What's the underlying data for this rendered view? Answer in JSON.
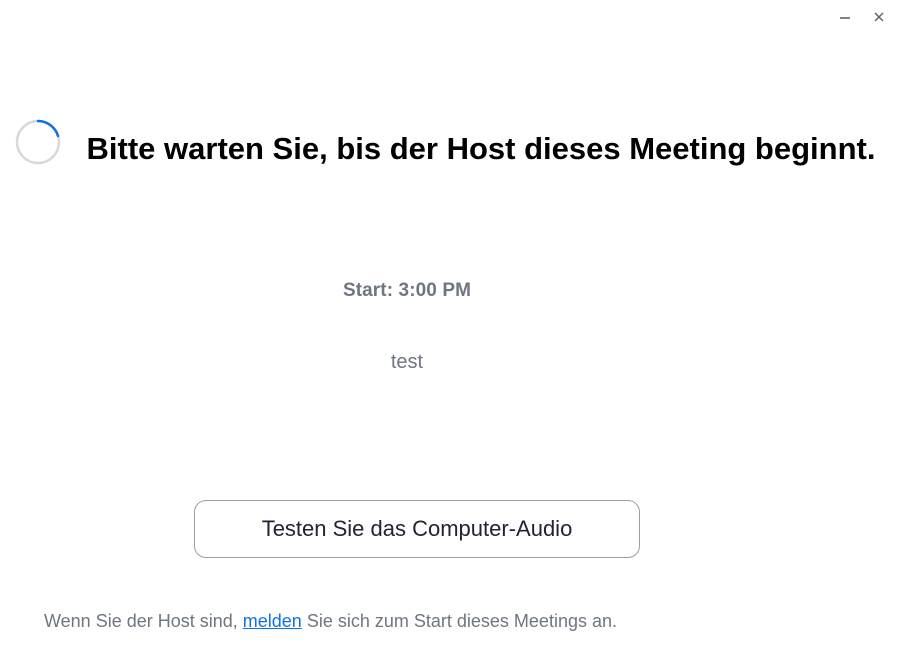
{
  "window": {
    "controls": {
      "minimize_icon": "minimize-icon",
      "close_icon": "close-icon"
    }
  },
  "waiting": {
    "spinner_icon": "loading-spinner-icon",
    "title": "Bitte warten Sie, bis der Host dieses Meeting beginnt."
  },
  "meeting": {
    "start_time": "Start: 3:00 PM",
    "topic": "test"
  },
  "actions": {
    "test_audio_label": "Testen Sie das Computer-Audio"
  },
  "host_note": {
    "prefix": "Wenn Sie der Host sind,",
    "link_label": "melden",
    "suffix": "Sie sich zum Start dieses Meetings an."
  },
  "colors": {
    "accent": "#0e71eb",
    "spinner_track": "#d6d9dc",
    "muted_text": "#6e7681"
  }
}
